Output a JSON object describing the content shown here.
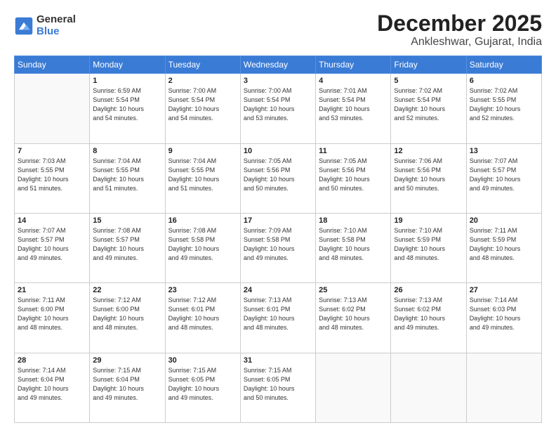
{
  "logo": {
    "general": "General",
    "blue": "Blue"
  },
  "title": "December 2025",
  "location": "Ankleshwar, Gujarat, India",
  "headers": [
    "Sunday",
    "Monday",
    "Tuesday",
    "Wednesday",
    "Thursday",
    "Friday",
    "Saturday"
  ],
  "weeks": [
    [
      {
        "day": "",
        "info": ""
      },
      {
        "day": "1",
        "info": "Sunrise: 6:59 AM\nSunset: 5:54 PM\nDaylight: 10 hours\nand 54 minutes."
      },
      {
        "day": "2",
        "info": "Sunrise: 7:00 AM\nSunset: 5:54 PM\nDaylight: 10 hours\nand 54 minutes."
      },
      {
        "day": "3",
        "info": "Sunrise: 7:00 AM\nSunset: 5:54 PM\nDaylight: 10 hours\nand 53 minutes."
      },
      {
        "day": "4",
        "info": "Sunrise: 7:01 AM\nSunset: 5:54 PM\nDaylight: 10 hours\nand 53 minutes."
      },
      {
        "day": "5",
        "info": "Sunrise: 7:02 AM\nSunset: 5:54 PM\nDaylight: 10 hours\nand 52 minutes."
      },
      {
        "day": "6",
        "info": "Sunrise: 7:02 AM\nSunset: 5:55 PM\nDaylight: 10 hours\nand 52 minutes."
      }
    ],
    [
      {
        "day": "7",
        "info": "Sunrise: 7:03 AM\nSunset: 5:55 PM\nDaylight: 10 hours\nand 51 minutes."
      },
      {
        "day": "8",
        "info": "Sunrise: 7:04 AM\nSunset: 5:55 PM\nDaylight: 10 hours\nand 51 minutes."
      },
      {
        "day": "9",
        "info": "Sunrise: 7:04 AM\nSunset: 5:55 PM\nDaylight: 10 hours\nand 51 minutes."
      },
      {
        "day": "10",
        "info": "Sunrise: 7:05 AM\nSunset: 5:56 PM\nDaylight: 10 hours\nand 50 minutes."
      },
      {
        "day": "11",
        "info": "Sunrise: 7:05 AM\nSunset: 5:56 PM\nDaylight: 10 hours\nand 50 minutes."
      },
      {
        "day": "12",
        "info": "Sunrise: 7:06 AM\nSunset: 5:56 PM\nDaylight: 10 hours\nand 50 minutes."
      },
      {
        "day": "13",
        "info": "Sunrise: 7:07 AM\nSunset: 5:57 PM\nDaylight: 10 hours\nand 49 minutes."
      }
    ],
    [
      {
        "day": "14",
        "info": "Sunrise: 7:07 AM\nSunset: 5:57 PM\nDaylight: 10 hours\nand 49 minutes."
      },
      {
        "day": "15",
        "info": "Sunrise: 7:08 AM\nSunset: 5:57 PM\nDaylight: 10 hours\nand 49 minutes."
      },
      {
        "day": "16",
        "info": "Sunrise: 7:08 AM\nSunset: 5:58 PM\nDaylight: 10 hours\nand 49 minutes."
      },
      {
        "day": "17",
        "info": "Sunrise: 7:09 AM\nSunset: 5:58 PM\nDaylight: 10 hours\nand 49 minutes."
      },
      {
        "day": "18",
        "info": "Sunrise: 7:10 AM\nSunset: 5:58 PM\nDaylight: 10 hours\nand 48 minutes."
      },
      {
        "day": "19",
        "info": "Sunrise: 7:10 AM\nSunset: 5:59 PM\nDaylight: 10 hours\nand 48 minutes."
      },
      {
        "day": "20",
        "info": "Sunrise: 7:11 AM\nSunset: 5:59 PM\nDaylight: 10 hours\nand 48 minutes."
      }
    ],
    [
      {
        "day": "21",
        "info": "Sunrise: 7:11 AM\nSunset: 6:00 PM\nDaylight: 10 hours\nand 48 minutes."
      },
      {
        "day": "22",
        "info": "Sunrise: 7:12 AM\nSunset: 6:00 PM\nDaylight: 10 hours\nand 48 minutes."
      },
      {
        "day": "23",
        "info": "Sunrise: 7:12 AM\nSunset: 6:01 PM\nDaylight: 10 hours\nand 48 minutes."
      },
      {
        "day": "24",
        "info": "Sunrise: 7:13 AM\nSunset: 6:01 PM\nDaylight: 10 hours\nand 48 minutes."
      },
      {
        "day": "25",
        "info": "Sunrise: 7:13 AM\nSunset: 6:02 PM\nDaylight: 10 hours\nand 48 minutes."
      },
      {
        "day": "26",
        "info": "Sunrise: 7:13 AM\nSunset: 6:02 PM\nDaylight: 10 hours\nand 49 minutes."
      },
      {
        "day": "27",
        "info": "Sunrise: 7:14 AM\nSunset: 6:03 PM\nDaylight: 10 hours\nand 49 minutes."
      }
    ],
    [
      {
        "day": "28",
        "info": "Sunrise: 7:14 AM\nSunset: 6:04 PM\nDaylight: 10 hours\nand 49 minutes."
      },
      {
        "day": "29",
        "info": "Sunrise: 7:15 AM\nSunset: 6:04 PM\nDaylight: 10 hours\nand 49 minutes."
      },
      {
        "day": "30",
        "info": "Sunrise: 7:15 AM\nSunset: 6:05 PM\nDaylight: 10 hours\nand 49 minutes."
      },
      {
        "day": "31",
        "info": "Sunrise: 7:15 AM\nSunset: 6:05 PM\nDaylight: 10 hours\nand 50 minutes."
      },
      {
        "day": "",
        "info": ""
      },
      {
        "day": "",
        "info": ""
      },
      {
        "day": "",
        "info": ""
      }
    ]
  ]
}
